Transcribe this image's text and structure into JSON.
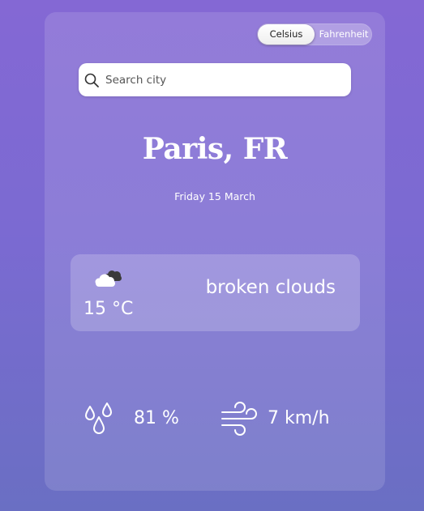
{
  "units": {
    "celsius_label": "Celsius",
    "fahrenheit_label": "Fahrenheit",
    "selected": "Celsius"
  },
  "search": {
    "placeholder": "Search city",
    "value": ""
  },
  "location": {
    "city": "Paris, FR",
    "date": "Friday 15 March"
  },
  "current": {
    "icon": "broken-clouds-icon",
    "temperature": "15 °C",
    "description": "broken clouds"
  },
  "stats": {
    "humidity": "81 %",
    "wind": "7 km/h"
  },
  "colors": {
    "background_top": "#8468d4",
    "background_bottom": "#6a6fc3",
    "text": "#ffffff"
  }
}
